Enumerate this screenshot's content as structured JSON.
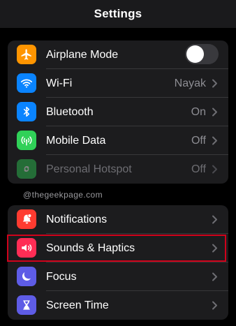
{
  "header": {
    "title": "Settings"
  },
  "group1": [
    {
      "label": "Airplane Mode",
      "icon": "airplane-icon",
      "color": "#ff9500",
      "toggle": false
    },
    {
      "label": "Wi-Fi",
      "icon": "wifi-icon",
      "color": "#0a84ff",
      "value": "Nayak"
    },
    {
      "label": "Bluetooth",
      "icon": "bluetooth-icon",
      "color": "#0a84ff",
      "value": "On"
    },
    {
      "label": "Mobile Data",
      "icon": "antenna-icon",
      "color": "#30d158",
      "value": "Off"
    },
    {
      "label": "Personal Hotspot",
      "icon": "hotspot-icon",
      "color": "#30d158",
      "value": "Off",
      "disabled": true
    }
  ],
  "watermark": "@thegeekpage.com",
  "group2": [
    {
      "label": "Notifications",
      "icon": "bell-icon",
      "color": "#ff3b30"
    },
    {
      "label": "Sounds & Haptics",
      "icon": "speaker-icon",
      "color": "#ff2d55",
      "highlighted": true,
      "highlight_color": "#d0021b"
    },
    {
      "label": "Focus",
      "icon": "moon-icon",
      "color": "#5e5ce6"
    },
    {
      "label": "Screen Time",
      "icon": "hourglass-icon",
      "color": "#5e5ce6"
    }
  ]
}
